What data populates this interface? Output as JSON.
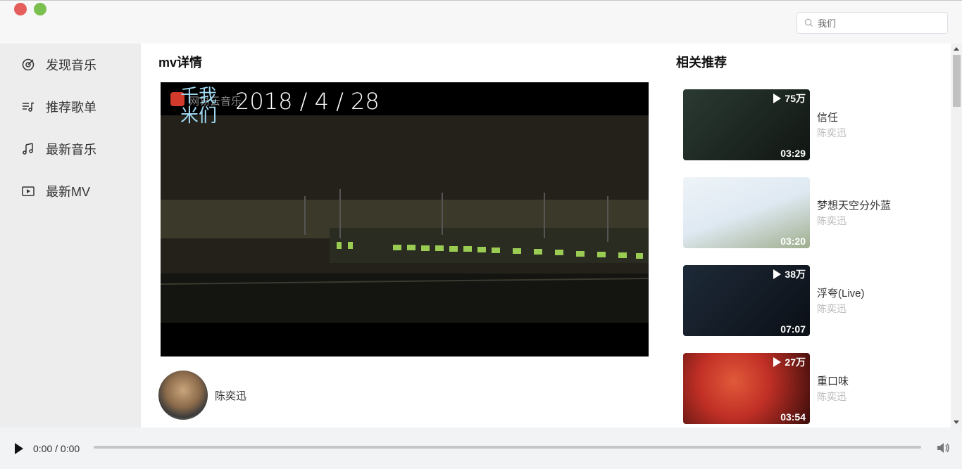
{
  "search": {
    "value": "我们"
  },
  "sidebar": {
    "items": [
      {
        "label": "发现音乐",
        "icon": "disc-target-icon"
      },
      {
        "label": "推荐歌单",
        "icon": "playlist-icon"
      },
      {
        "label": "最新音乐",
        "icon": "music-note-icon"
      },
      {
        "label": "最新MV",
        "icon": "video-play-icon"
      }
    ]
  },
  "mv": {
    "section_title": "mv详情",
    "overlay_text": "2018 / 4 / 28",
    "brand_text": "网易云音乐",
    "poem_text": "千我\n米们",
    "artist": "陈奕迅"
  },
  "related": {
    "section_title": "相关推荐",
    "items": [
      {
        "name": "信任",
        "singer": "陈奕迅",
        "play_count": "75万",
        "duration": "03:29",
        "colors": [
          "#2b3a33",
          "#111612"
        ]
      },
      {
        "name": "梦想天空分外蓝",
        "singer": "陈奕迅",
        "play_count": "",
        "duration": "03:20",
        "colors": [
          "#dfe9f2",
          "#9fae8e"
        ]
      },
      {
        "name": "浮夸(Live)",
        "singer": "陈奕迅",
        "play_count": "38万",
        "duration": "07:07",
        "colors": [
          "#1e2a38",
          "#0b0f16"
        ]
      },
      {
        "name": "重口味",
        "singer": "陈奕迅",
        "play_count": "27万",
        "duration": "03:54",
        "colors": [
          "#c23026",
          "#3a0c0a"
        ]
      }
    ]
  },
  "player": {
    "time": "0:00 / 0:00"
  }
}
